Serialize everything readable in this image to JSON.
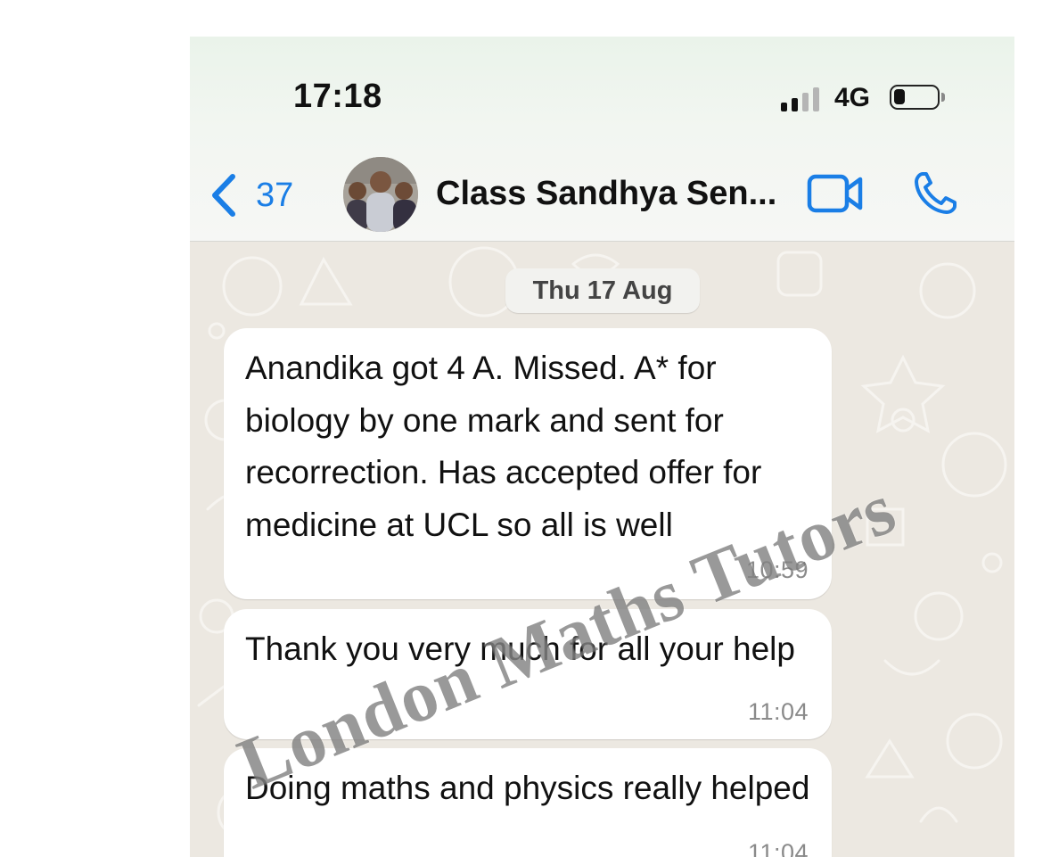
{
  "status_bar": {
    "time": "17:18",
    "network": "4G",
    "signal_bars_active": 2,
    "signal_bars_total": 4,
    "battery_level": 0.25
  },
  "header": {
    "back_icon": "chevron-left-icon",
    "back_count": "37",
    "title": "Class Sandhya Sen...",
    "video_icon": "video-camera-icon",
    "call_icon": "phone-icon"
  },
  "chat": {
    "date_label": "Thu 17 Aug",
    "messages": [
      {
        "text": "Anandika got 4 A. Missed. A* for biology by one mark and sent for recorrection. Has accepted offer for medicine at UCL so all is well",
        "time": "10:59"
      },
      {
        "text": "Thank you very much for all your help",
        "time": "11:04"
      },
      {
        "text": "Doing maths and physics really helped",
        "time": "11:04"
      }
    ]
  },
  "watermark": "London Maths Tutors",
  "colors": {
    "accent": "#1a7ee6",
    "chat_background": "#ece8e1",
    "bubble": "#ffffff",
    "timestamp": "#8a8a8a"
  }
}
